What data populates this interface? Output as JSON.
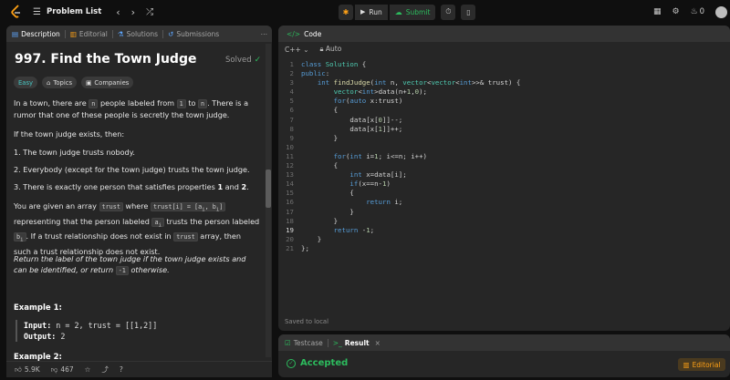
{
  "topbar": {
    "problem_list": "Problem List",
    "run": "Run",
    "submit": "Submit",
    "streak": "0"
  },
  "left": {
    "tabs": [
      "Description",
      "Editorial",
      "Solutions",
      "Submissions"
    ],
    "title": "997. Find the Town Judge",
    "solved": "Solved",
    "chips": [
      "Easy",
      "Topics",
      "Companies"
    ],
    "p1": [
      "In a town, there are ",
      "n",
      " people labeled from ",
      "1",
      " to ",
      "n",
      ". There is a rumor that one of these people is secretly the town judge."
    ],
    "p2": "If the town judge exists, then:",
    "items": [
      "1. The town judge trusts nobody.",
      "2. Everybody (except for the town judge) trusts the town judge.",
      "3. There is exactly one person that satisfies properties ",
      "1",
      " and ",
      "2",
      "."
    ],
    "p3": [
      "You are given an array ",
      "trust",
      " where ",
      "trust[i] = [a",
      "i",
      ", b",
      "i",
      "]",
      " representing that the person labeled ",
      "a",
      "i",
      " trusts the person labeled ",
      "b",
      "i",
      ". If a trust relationship does not exist in ",
      "trust",
      " array, then such a trust relationship does not exist."
    ],
    "p4": [
      "Return the label of the town judge if the town judge exists and can be identified, or return ",
      "-1",
      " otherwise."
    ],
    "example1": "Example 1:",
    "ex_input_k": "Input:",
    "ex_input_v": " n = 2, trust = [[1,2]]",
    "ex_output_k": "Output:",
    "ex_output_v": " 2",
    "example2": "Example 2:",
    "likes": "5.9K",
    "dislikes": "467"
  },
  "code": {
    "header": "Code",
    "lang": "C++",
    "auto": "Auto",
    "saved": "Saved to local",
    "lines": [
      "class Solution {",
      "public:",
      "    int findJudge(int n, vector<vector<int>>& trust) {",
      "        vector<int>data(n+1,0);",
      "        for(auto x:trust)",
      "        {",
      "            data[x[0]]--;",
      "            data[x[1]]++;",
      "        }",
      "",
      "        for(int i=1; i<=n; i++)",
      "        {",
      "            int x=data[i];",
      "            if(x==n-1)",
      "            {",
      "                return i;",
      "            }",
      "        }",
      "        return -1;",
      "    }",
      "};"
    ]
  },
  "result": {
    "testcase": "Testcase",
    "result": "Result",
    "accepted": "Accepted",
    "editorial": "Editorial"
  }
}
